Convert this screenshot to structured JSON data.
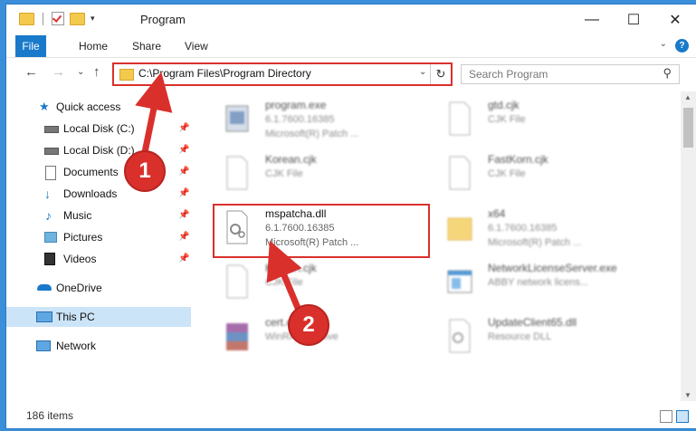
{
  "window": {
    "title": "Program",
    "controls": {
      "minimize": "—",
      "maximize": "☐",
      "close": "✕"
    }
  },
  "ribbon": {
    "tabs": [
      "File",
      "Home",
      "Share",
      "View"
    ],
    "help_label": "?",
    "collapse_label": "⌄"
  },
  "nav": {
    "back": "←",
    "forward": "→",
    "recent": "⌄",
    "up": "↑",
    "address": "C:\\Program Files\\Program Directory",
    "address_chevron": "⌄",
    "refresh": "↻",
    "search_placeholder": "Search Program",
    "search_icon": "⚲"
  },
  "sidebar": {
    "pin_glyph": "📌",
    "items": [
      {
        "label": "Quick access",
        "icon": "star-icon"
      },
      {
        "label": "Local Disk (C:)",
        "icon": "drive-icon",
        "pinned": true
      },
      {
        "label": "Local Disk (D:)",
        "icon": "drive-icon",
        "pinned": true
      },
      {
        "label": "Documents",
        "icon": "documents-icon",
        "pinned": true
      },
      {
        "label": "Downloads",
        "icon": "downloads-icon",
        "pinned": true
      },
      {
        "label": "Music",
        "icon": "music-icon",
        "pinned": true
      },
      {
        "label": "Pictures",
        "icon": "pictures-icon",
        "pinned": true
      },
      {
        "label": "Videos",
        "icon": "videos-icon",
        "pinned": true
      },
      {
        "label": "OneDrive",
        "icon": "cloud-icon"
      },
      {
        "label": "This PC",
        "icon": "computer-icon",
        "selected": true
      },
      {
        "label": "Network",
        "icon": "network-icon"
      }
    ]
  },
  "files": [
    {
      "name": "program.exe",
      "type": "6.1.7600.16385",
      "desc": "Microsoft(R) Patch ...",
      "icon": "exe-icon"
    },
    {
      "name": "gtd.cjk",
      "type": "CJK File",
      "desc": "",
      "icon": "file-icon"
    },
    {
      "name": "Korean.cjk",
      "type": "CJK File",
      "desc": "",
      "icon": "file-icon"
    },
    {
      "name": "FastKorn.cjk",
      "type": "CJK File",
      "desc": "",
      "icon": "file-icon"
    },
    {
      "name": "mspatcha.dll",
      "type": "6.1.7600.16385",
      "desc": "Microsoft(R) Patch ...",
      "icon": "dll-gear-icon"
    },
    {
      "name": "x64",
      "type": "6.1.7600.16385",
      "desc": "Microsoft(R) Patch ...",
      "icon": "folder-icon"
    },
    {
      "name": "Korean.cjk",
      "type": "CJK File",
      "desc": "",
      "icon": "file-icon"
    },
    {
      "name": "NetworkLicenseServer.exe",
      "type": "ABBY network licens...",
      "desc": "",
      "icon": "app-window-icon"
    },
    {
      "name": "cert.cab",
      "type": "WinRAR archive",
      "desc": "",
      "icon": "archive-icon"
    },
    {
      "name": "UpdateClient65.dll",
      "type": "Resource DLL",
      "desc": "",
      "icon": "dll-gear-icon"
    }
  ],
  "annotations": {
    "step1": "1",
    "step2": "2"
  },
  "status": {
    "count": "186 items"
  },
  "colors": {
    "accent": "#1979ca",
    "annotation_red": "#d9302c",
    "selected": "#cce4f7",
    "desktop": "#3a8fd8"
  }
}
